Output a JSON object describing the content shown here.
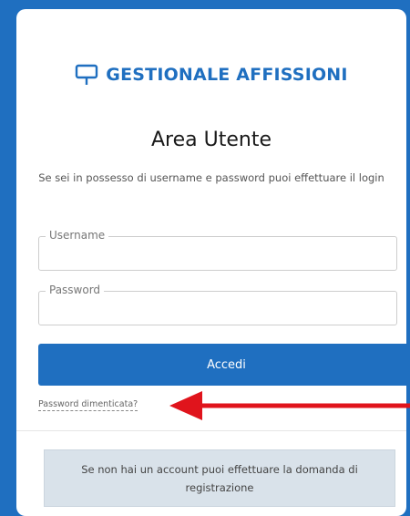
{
  "brand": {
    "name": "GESTIONALE AFFISSIONI",
    "icon": "billboard-icon",
    "color": "#1f6fc0"
  },
  "login": {
    "title": "Area Utente",
    "subtitle": "Se sei in possesso di username e password puoi effettuare il login",
    "username_label": "Username",
    "username_value": "",
    "password_label": "Password",
    "password_value": "",
    "submit_label": "Accedi",
    "forgot_label": "Password dimenticata?"
  },
  "register": {
    "text": "Se non hai un account puoi effettuare la domanda di registrazione"
  },
  "annotation": {
    "icon": "red-arrow-icon",
    "color": "#e0141c"
  }
}
